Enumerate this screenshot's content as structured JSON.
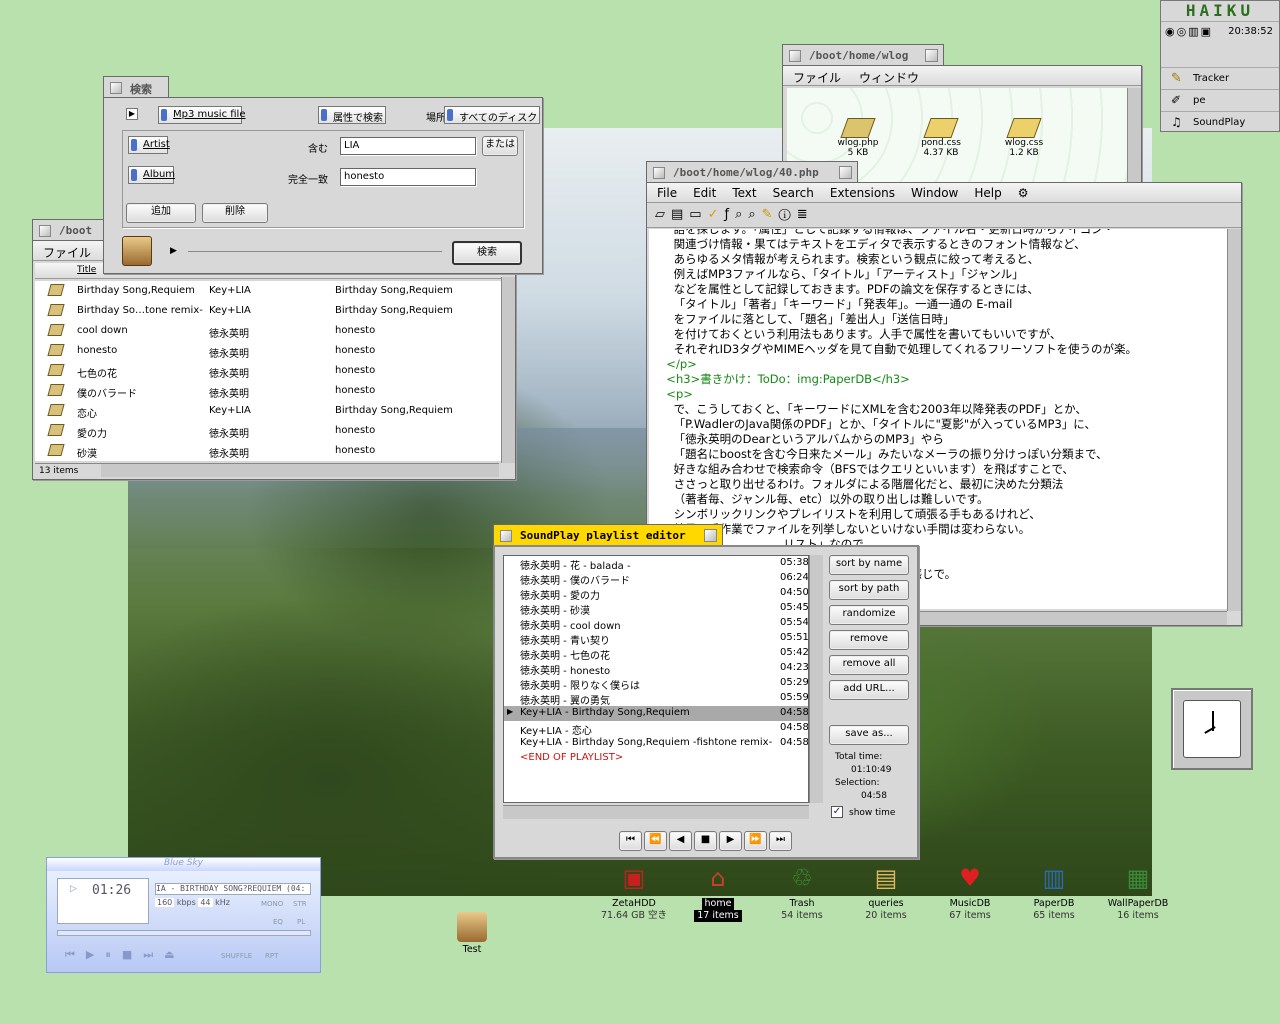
{
  "deskbar": {
    "logo": "HAIKU",
    "clock": "20:38:52",
    "items": [
      "Tracker",
      "pe",
      "SoundPlay"
    ]
  },
  "query": {
    "title": "検索",
    "type_value": "Mp3 music file",
    "by_attr": "属性で検索",
    "place_label": "場所",
    "place_value": "すべてのディスク",
    "attr1": "Artist",
    "op1": "含む",
    "val1": "LIA",
    "or_btn": "または",
    "attr2": "Album",
    "op2": "完全一致",
    "val2": "honesto",
    "add": "追加",
    "remove": "削除",
    "search": "検索"
  },
  "tracker_list": {
    "title": "/boot",
    "menu": "ファイル",
    "col_title": "Title",
    "status": "13 items",
    "rows": [
      {
        "title": "Birthday Song,Requiem",
        "artist": "Key+LIA",
        "album": "Birthday Song,Requiem"
      },
      {
        "title": "Birthday So…tone remix-",
        "artist": "Key+LIA",
        "album": "Birthday Song,Requiem"
      },
      {
        "title": "cool down",
        "artist": "徳永英明",
        "album": "honesto"
      },
      {
        "title": "honesto",
        "artist": "徳永英明",
        "album": "honesto"
      },
      {
        "title": "七色の花",
        "artist": "徳永英明",
        "album": "honesto"
      },
      {
        "title": "僕のバラード",
        "artist": "徳永英明",
        "album": "honesto"
      },
      {
        "title": "恋心",
        "artist": "Key+LIA",
        "album": "Birthday Song,Requiem"
      },
      {
        "title": "愛の力",
        "artist": "徳永英明",
        "album": "honesto"
      },
      {
        "title": "砂漠",
        "artist": "徳永英明",
        "album": "honesto"
      }
    ]
  },
  "wlog": {
    "title": "/boot/home/wlog",
    "menu": [
      "ファイル",
      "ウィンドウ"
    ],
    "files": [
      {
        "name": "wlog.php",
        "size": "5 KB"
      },
      {
        "name": "pond.css",
        "size": "4.37 KB"
      },
      {
        "name": "wlog.css",
        "size": "1.2 KB"
      }
    ]
  },
  "editor": {
    "title": "/boot/home/wlog/40.php",
    "menu": [
      "File",
      "Edit",
      "Text",
      "Search",
      "Extensions",
      "Window",
      "Help"
    ],
    "lines": [
      "    語を探します。「属性」として記録する情報は、ファイル名・更新日時からアイコン・",
      "    関連づけ情報・果てはテキストをエディタで表示するときのフォント情報など、",
      "    あらゆるメタ情報が考えられます。検索という観点に絞って考えると、",
      "    例えばMP3ファイルなら、「タイトル」「アーティスト」「ジャンル」",
      "    などを属性として記録しておきます。PDFの論文を保存するときには、",
      "    「タイトル」「著者」「キーワード」「発表年」。一通一通の E-mail",
      "    をファイルに落として、「題名」「差出人」「送信日時」",
      "    を付けておくという利用法もあります。人手で属性を書いてもいいですが、",
      "    それぞれID3タグやMIMEヘッダを見て自動で処理してくれるフリーソフトを使うのが楽。",
      "  </p>",
      "  <h3>書きかけ：ToDo：img:PaperDB</h3>",
      "  <p>",
      "    で、こうしておくと、「キーワードにXMLを含む2003年以降発表のPDF」とか、",
      "    「P.WadlerのJava関係のPDF」とか、「タイトルに\"夏影\"が入っているMP3」に、",
      "    「徳永英明のDearというアルバムからのMP3」やら",
      "    「題名にboostを含む今日来たメール」みたいなメーラの振り分けっぽい分類まで、",
      "    好きな組み合わせで検索命令（BFSではクエリといいます）を飛ばすことで、",
      "    ささっと取り出せるわけ。フォルダによる階層化だと、最初に決めた分類法",
      "    （著者毎、ジャンル毎、etc）以外の取り出しは難しいです。",
      "    シンボリックリンクやプレイリストを利用して頑張る手もあるけれど、",
      "    結局、手作業でファイルを列挙しないといけない手間は変わらない。",
      "",
      "",
      "                                  リスト」なので、",
      "                                  ずに扱ってくれます。",
      "                                  ntryList から派生してる感じで。"
    ]
  },
  "playlist": {
    "title": "SoundPlay playlist editor",
    "rows": [
      {
        "t": "徳永英明 - 花 - balada -",
        "d": "05:38"
      },
      {
        "t": "徳永英明 - 僕のバラード",
        "d": "06:24"
      },
      {
        "t": "徳永英明 - 愛の力",
        "d": "04:50"
      },
      {
        "t": "徳永英明 - 砂漠",
        "d": "05:45"
      },
      {
        "t": "徳永英明 - cool down",
        "d": "05:54"
      },
      {
        "t": "徳永英明 - 青い契り",
        "d": "05:51"
      },
      {
        "t": "徳永英明 - 七色の花",
        "d": "05:42"
      },
      {
        "t": "徳永英明 - honesto",
        "d": "04:23"
      },
      {
        "t": "徳永英明 - 限りなく僕らは",
        "d": "05:29"
      },
      {
        "t": "徳永英明 - 翼の勇気",
        "d": "05:59"
      },
      {
        "t": "Key+LIA - Birthday Song,Requiem",
        "d": "04:58"
      },
      {
        "t": "Key+LIA - 恋心",
        "d": "04:58"
      },
      {
        "t": "Key+LIA - Birthday Song,Requiem -fishtone remix-",
        "d": "04:58"
      }
    ],
    "end": "<END OF PLAYLIST>",
    "buttons": [
      "sort by name",
      "sort by path",
      "randomize",
      "remove",
      "remove all",
      "add URL...",
      "save as..."
    ],
    "total_label": "Total time:",
    "total": "01:10:49",
    "sel_label": "Selection:",
    "sel": "04:58",
    "show_time": "show time"
  },
  "player": {
    "skin": "Blue Sky",
    "time": "01:26",
    "track": "IA - BIRTHDAY SONG?REQUIEM (04:",
    "kbps": "160",
    "khz": "44",
    "labels": [
      "kbps",
      "kHz",
      "MONO",
      "STR",
      "EQ",
      "PL",
      "SHUFFLE",
      "RPT"
    ]
  },
  "desktop": [
    {
      "name": "ZetaHDD",
      "sub": "71.64 GB 空き",
      "glyph": "▣"
    },
    {
      "name": "home",
      "sub": "17 items",
      "glyph": "⌂"
    },
    {
      "name": "Trash",
      "sub": "54 items",
      "glyph": "♲"
    },
    {
      "name": "queries",
      "sub": "20 items",
      "glyph": "▤"
    },
    {
      "name": "MusicDB",
      "sub": "67 items",
      "glyph": "♥"
    },
    {
      "name": "PaperDB",
      "sub": "65 items",
      "glyph": "▥"
    },
    {
      "name": "WallPaperDB",
      "sub": "16 items",
      "glyph": "▦"
    }
  ],
  "test_icon": {
    "name": "Test"
  }
}
